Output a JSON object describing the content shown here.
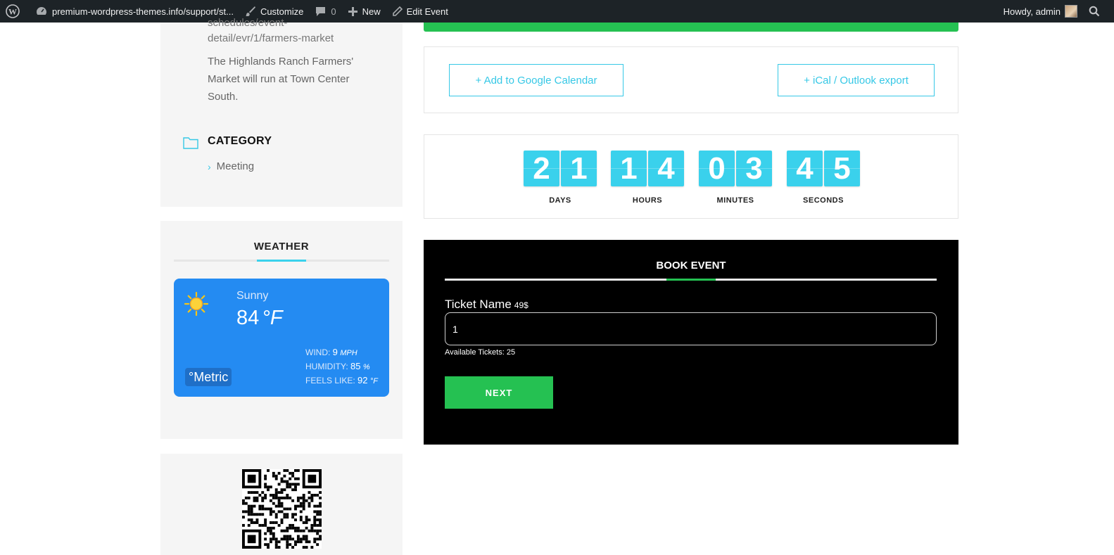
{
  "adminbar": {
    "site_url": "premium-wordpress-themes.info/support/st...",
    "customize": "Customize",
    "comments_count": "0",
    "new": "New",
    "edit_event": "Edit Event",
    "howdy": "Howdy, admin"
  },
  "location": {
    "url_fragment": "schedules/event-detail/evr/1/farmers-market",
    "description": "The Highlands Ranch Farmers' Market will run at Town Center South."
  },
  "category": {
    "heading": "CATEGORY",
    "item": "Meeting"
  },
  "weather": {
    "title": "WEATHER",
    "condition": "Sunny",
    "temperature": "84",
    "temp_unit": "°F",
    "wind_label": "WIND:",
    "wind_value": "9",
    "wind_unit": "MPH",
    "humidity_label": "HUMIDITY:",
    "humidity_value": "85",
    "humidity_unit": "%",
    "feels_label": "FEELS LIKE:",
    "feels_value": "92",
    "feels_unit": "°F",
    "metric_toggle": "°Metric",
    "card_color": "#248bf2"
  },
  "calendar": {
    "google": "+ Add to Google Calendar",
    "ical": "+ iCal / Outlook export"
  },
  "countdown": {
    "days": [
      "2",
      "1"
    ],
    "hours": [
      "1",
      "4"
    ],
    "minutes": [
      "0",
      "3"
    ],
    "seconds": [
      "4",
      "5"
    ],
    "days_label": "DAYS",
    "hours_label": "HOURS",
    "minutes_label": "MINUTES",
    "seconds_label": "SECONDS",
    "digit_color": "#3ad1ec"
  },
  "booking": {
    "title": "BOOK EVENT",
    "ticket_name": "Ticket Name",
    "price": "49$",
    "quantity": "1",
    "available": "Available Tickets: 25",
    "next": "NEXT",
    "accent": "#25c152"
  }
}
